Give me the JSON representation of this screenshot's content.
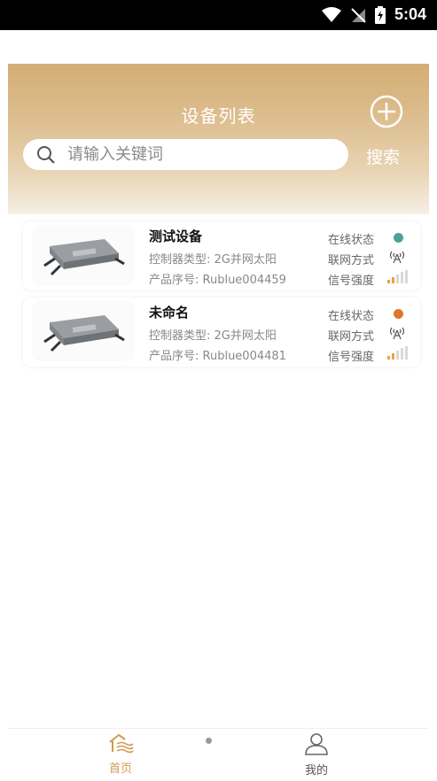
{
  "status_bar": {
    "time": "5:04"
  },
  "header": {
    "title": "设备列表",
    "search_placeholder": "请输入关键词",
    "search_button": "搜索"
  },
  "devices": [
    {
      "name": "测试设备",
      "controller_type": "控制器类型: 2G并网太阳",
      "serial": "产品序号: Rublue004459",
      "online_label": "在线状态",
      "network_label": "联网方式",
      "signal_label": "信号强度",
      "online_color": "#4aa39a",
      "signal_level": 0.4
    },
    {
      "name": "未命名",
      "controller_type": "控制器类型: 2G并网太阳",
      "serial": "产品序号: Rublue004481",
      "online_label": "在线状态",
      "network_label": "联网方式",
      "signal_label": "信号强度",
      "online_color": "#e0762a",
      "signal_level": 0.4
    }
  ],
  "tabbar": {
    "home_label": "首页",
    "mine_label": "我的",
    "active_color": "#d19a52"
  }
}
